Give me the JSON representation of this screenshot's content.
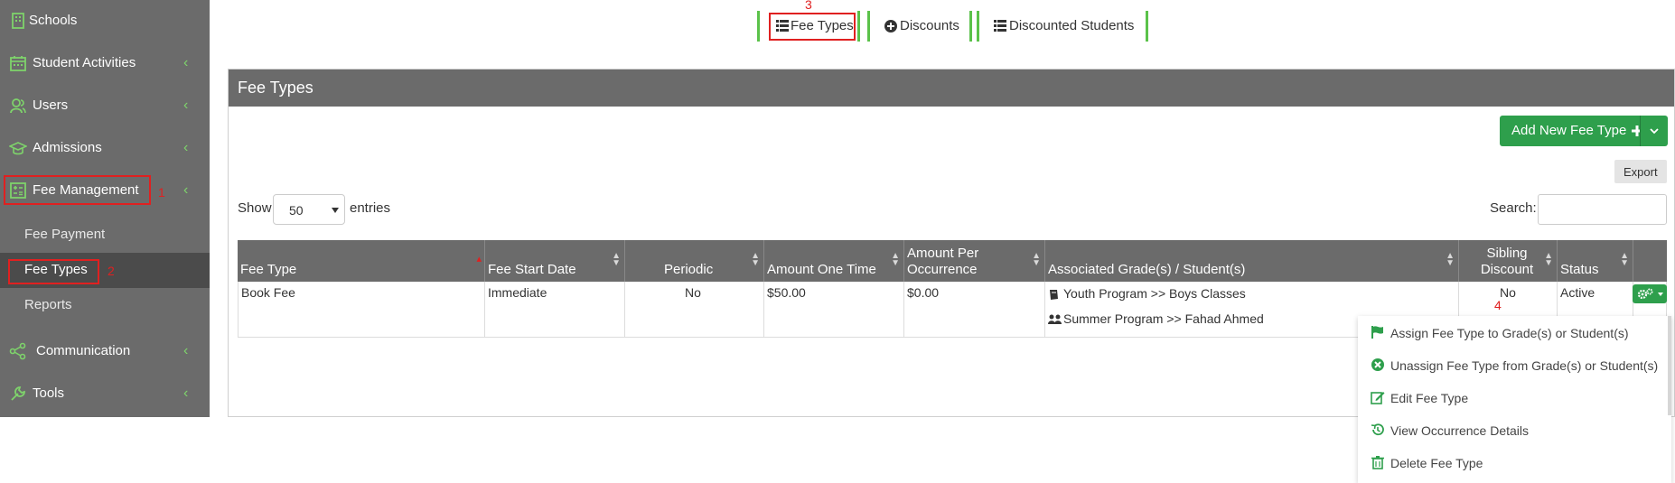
{
  "sidebar": {
    "items": [
      {
        "label": "Schools",
        "icon": "building-icon"
      },
      {
        "label": "Student Activities",
        "icon": "calendar-icon"
      },
      {
        "label": "Users",
        "icon": "users-icon"
      },
      {
        "label": "Admissions",
        "icon": "graduation-cap-icon"
      },
      {
        "label": "Fee Management",
        "icon": "calculator-icon"
      },
      {
        "label": "Communication",
        "icon": "share-icon"
      },
      {
        "label": "Tools",
        "icon": "wrench-icon"
      }
    ],
    "subitems": [
      {
        "label": "Fee Payment"
      },
      {
        "label": "Fee Types"
      },
      {
        "label": "Reports"
      }
    ],
    "chevron": "‹"
  },
  "annotations": {
    "n1": "1",
    "n2": "2",
    "n3": "3",
    "n4": "4"
  },
  "top_tabs": [
    {
      "label": "Fee Types",
      "icon": "list-icon"
    },
    {
      "label": "Discounts",
      "icon": "plus-circle-icon"
    },
    {
      "label": "Discounted Students",
      "icon": "list-icon"
    }
  ],
  "panel": {
    "title": "Fee Types",
    "add_button": "Add New Fee Type",
    "export_button": "Export",
    "show_label": "Show",
    "entries_value": "50",
    "entries_label": "entries",
    "search_label": "Search:",
    "search_value": ""
  },
  "table": {
    "headers": [
      "Fee Type",
      "Fee Start Date",
      "Periodic",
      "Amount One Time",
      "Amount Per Occurrence",
      "Associated Grade(s) / Student(s)",
      "Sibling Discount",
      "Status"
    ],
    "rows": [
      {
        "fee_type": "Book Fee",
        "start_date": "Immediate",
        "periodic": "No",
        "amount_one_time": "$50.00",
        "amount_per_occurrence": "$0.00",
        "associated": [
          "Youth Program >> Boys Classes",
          "Summer Program >> Fahad Ahmed"
        ],
        "sibling_discount": "No",
        "status": "Active"
      }
    ]
  },
  "menu": {
    "items": [
      {
        "label": "Assign Fee Type to Grade(s) or Student(s)",
        "icon": "flag-icon"
      },
      {
        "label": "Unassign Fee Type from Grade(s) or Student(s)",
        "icon": "times-circle-icon"
      },
      {
        "label": "Edit Fee Type",
        "icon": "edit-icon"
      },
      {
        "label": "View Occurrence Details",
        "icon": "history-icon"
      },
      {
        "label": "Delete Fee Type",
        "icon": "trash-icon"
      }
    ]
  },
  "colors": {
    "accent_green": "#2e9f4c",
    "sidebar_bg": "#6b6b6b",
    "annotation_red": "#e02020"
  }
}
